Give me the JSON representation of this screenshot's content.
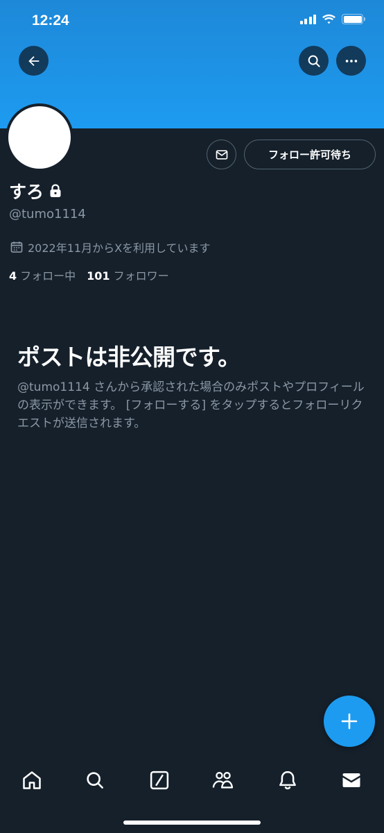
{
  "status_bar": {
    "time": "12:24"
  },
  "profile": {
    "display_name": "すろ",
    "handle": "@tumo1114",
    "joined": "2022年11月からXを利用しています",
    "following_count": "4",
    "following_label": "フォロー中",
    "followers_count": "101",
    "followers_label": "フォロワー"
  },
  "actions": {
    "follow_pending_label": "フォロー許可待ち"
  },
  "private_notice": {
    "title": "ポストは非公開です。",
    "description": "@tumo1114 さんから承認された場合のみポストやプロフィールの表示ができます。 [フォローする] をタップするとフォローリクエストが送信されます。"
  },
  "colors": {
    "background": "#15202b",
    "banner": "#1d9bf0",
    "accent": "#1d9bf0",
    "secondary_text": "#8b98a5",
    "border": "#536471"
  },
  "icons": {
    "back": "arrow-left-icon",
    "search": "search-icon",
    "more": "more-horizontal-icon",
    "mail": "mail-icon",
    "lock": "lock-icon",
    "calendar": "calendar-icon",
    "compose": "plus-icon",
    "nav": [
      "home-icon",
      "search-icon",
      "grok-icon",
      "communities-icon",
      "bell-icon",
      "mail-icon"
    ]
  }
}
